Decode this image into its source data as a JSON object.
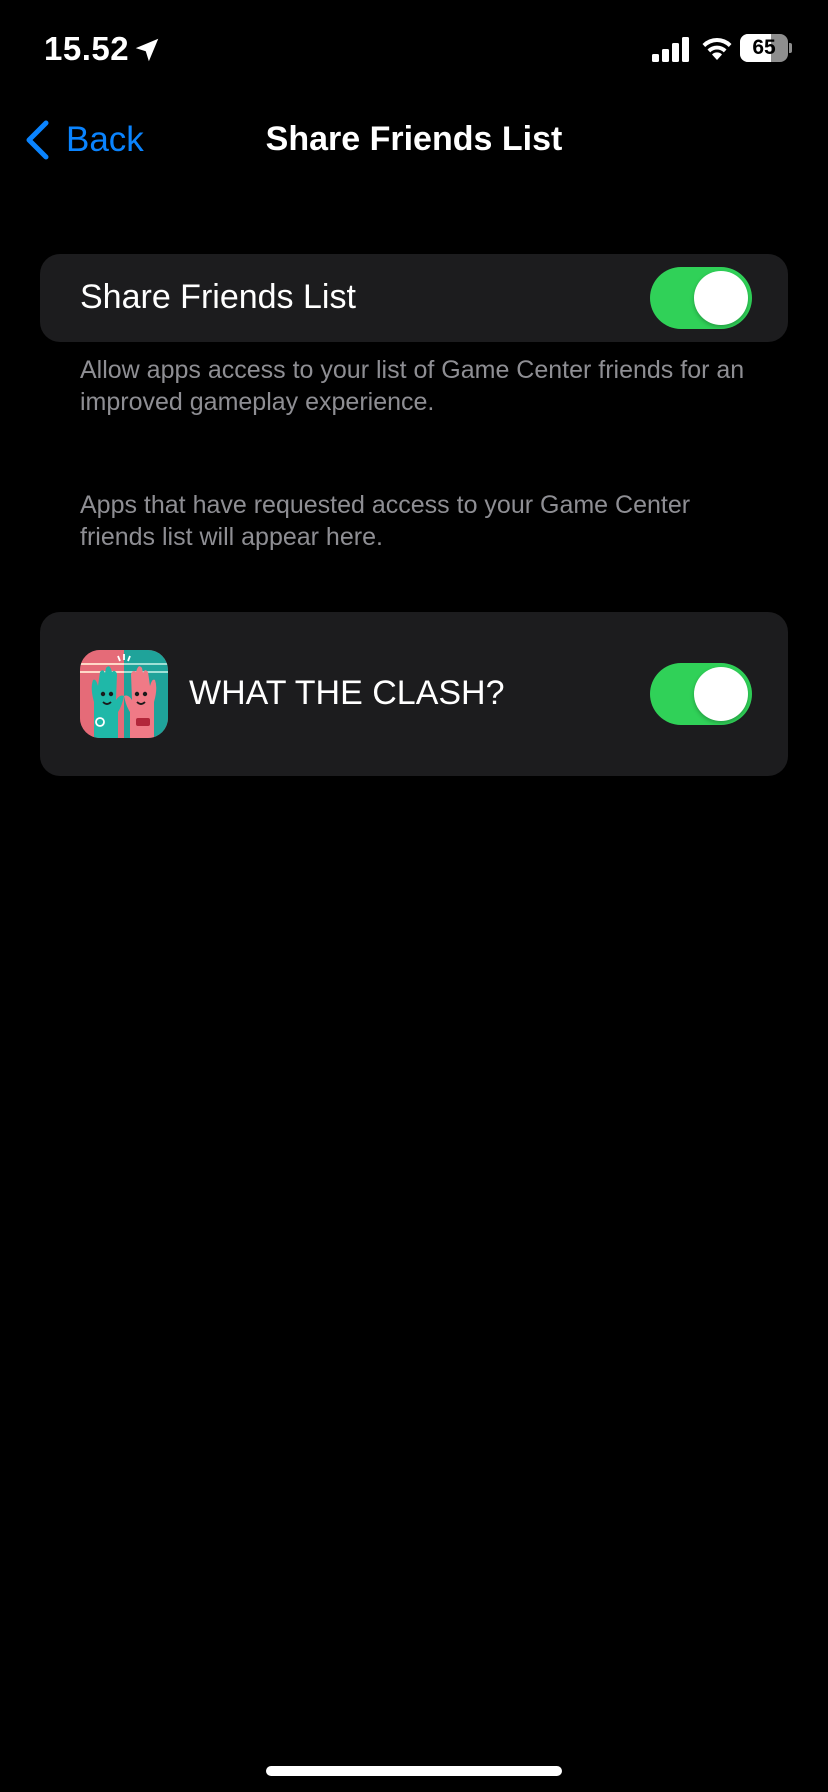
{
  "status_bar": {
    "time": "15.52",
    "battery_percent": 65,
    "battery_label": "65",
    "icons": [
      "location-arrow-icon",
      "cellular-signal-icon",
      "wifi-icon",
      "battery-icon"
    ]
  },
  "nav": {
    "back_label": "Back",
    "back_icon": "chevron-left-icon",
    "title": "Share Friends List"
  },
  "share_section": {
    "label": "Share Friends List",
    "toggle_on": true,
    "footer": "Allow apps access to your list of Game Center friends for an improved gameplay experience."
  },
  "apps_section": {
    "footer": "Apps that have requested access to your Game Center friends list will appear here.",
    "items": [
      {
        "name": "WHAT THE CLASH?",
        "icon": "what-the-clash-app-icon",
        "toggle_on": true
      }
    ]
  },
  "colors": {
    "background": "#000000",
    "card": "#1c1c1e",
    "accent": "#0a84ff",
    "toggle_on": "#30d158",
    "secondary_text": "#8e8e93"
  }
}
